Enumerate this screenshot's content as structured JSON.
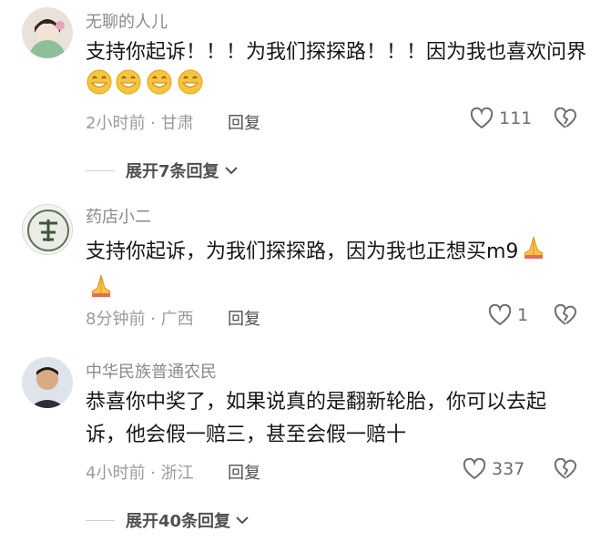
{
  "comments": [
    {
      "username": "无聊的人儿",
      "text": "支持你起诉！！！为我们探探路！！！因为我也喜欢问界",
      "emojis": [
        "grin-emoji",
        "grin-emoji",
        "grin-emoji",
        "grin-emoji"
      ],
      "meta": "2小时前 · 甘肃",
      "reply_label": "回复",
      "likes": "111",
      "expand_label": "展开7条回复"
    },
    {
      "username": "药店小二",
      "text": "支持你起诉，为我们探探路，因为我也正想买m9",
      "emojis": [
        "pray-emoji",
        "pray-emoji"
      ],
      "meta": "8分钟前 · 广西",
      "reply_label": "回复",
      "likes": "1"
    },
    {
      "username": "中华民族普通农民",
      "text": "恭喜你中奖了，如果说真的是翻新轮胎，你可以去起诉，他会假一赔三，甚至会假一赔十",
      "meta": "4小时前 · 浙江",
      "reply_label": "回复",
      "likes": "337",
      "expand_label": "展开40条回复"
    }
  ],
  "colors": {
    "text": "#161616",
    "meta": "#9b9b9b",
    "username": "#8a8a8a"
  }
}
